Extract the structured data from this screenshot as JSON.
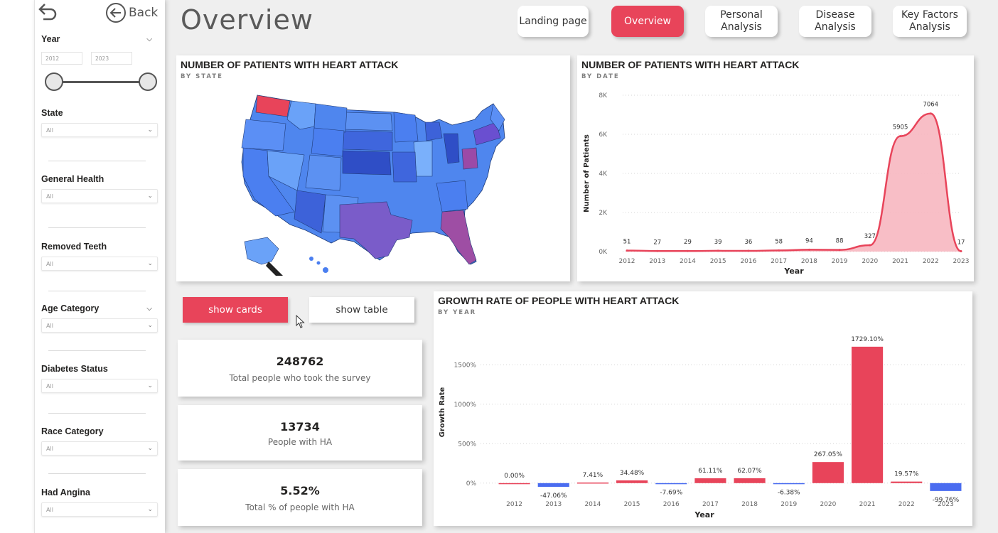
{
  "nav": {
    "back_label": "Back",
    "page_title": "Overview",
    "buttons": [
      "Landing page",
      "Overview",
      "Personal\nAnalysis",
      "Disease\nAnalysis",
      "Key Factors\nAnalysis"
    ]
  },
  "filters": {
    "year": {
      "title": "Year",
      "from": "2012",
      "to": "2023"
    },
    "state": {
      "title": "State",
      "value": "All"
    },
    "general_health": {
      "title": "General Health",
      "value": "All"
    },
    "removed_teeth": {
      "title": "Removed Teeth",
      "value": "All"
    },
    "age_category": {
      "title": "Age Category",
      "value": "All"
    },
    "diabetes_status": {
      "title": "Diabetes Status",
      "value": "All"
    },
    "race_category": {
      "title": "Race Category",
      "value": "All"
    },
    "had_angina": {
      "title": "Had Angina",
      "value": "All"
    }
  },
  "map_panel": {
    "title": "NUMBER OF PATIENTS WITH HEART ATTACK",
    "subtitle": "BY STATE"
  },
  "toggle": {
    "show_cards": "show cards",
    "show_table": "show table"
  },
  "cards": [
    {
      "value": "248762",
      "label": "Total people who took the survey"
    },
    {
      "value": "13734",
      "label": "People with HA"
    },
    {
      "value": "5.52%",
      "label": "Total % of people with HA"
    }
  ],
  "colors": {
    "accent": "#e8445a",
    "negative": "#4a6cf0",
    "area_fill": "#f7b7c0"
  },
  "chart_data": [
    {
      "type": "area",
      "title": "NUMBER OF PATIENTS WITH HEART ATTACK",
      "subtitle": "BY DATE",
      "xlabel": "Year",
      "ylabel": "Number of Patients",
      "categories": [
        "2012",
        "2013",
        "2014",
        "2015",
        "2016",
        "2017",
        "2018",
        "2019",
        "2020",
        "2021",
        "2022",
        "2023"
      ],
      "values": [
        51,
        27,
        29,
        39,
        36,
        58,
        94,
        88,
        327,
        5905,
        7064,
        17
      ],
      "data_labels": [
        "51",
        "27",
        "29",
        "39",
        "36",
        "58",
        "94",
        "88",
        "327",
        "5905",
        "7064",
        "17"
      ],
      "yticks": [
        "0K",
        "2K",
        "4K",
        "6K",
        "8K"
      ],
      "ylim": [
        0,
        8000
      ],
      "grid": true
    },
    {
      "type": "bar",
      "title": "GROWTH RATE OF PEOPLE WITH HEART ATTACK",
      "subtitle": "BY YEAR",
      "xlabel": "Year",
      "ylabel": "Growth Rate",
      "categories": [
        "2012",
        "2013",
        "2014",
        "2015",
        "2016",
        "2017",
        "2018",
        "2019",
        "2020",
        "2021",
        "2022",
        "2023"
      ],
      "values": [
        0.0,
        -47.06,
        7.41,
        34.48,
        -7.69,
        61.11,
        62.07,
        -6.38,
        267.05,
        1729.1,
        19.57,
        -99.76
      ],
      "data_labels": [
        "0.00%",
        "-47.06%",
        "7.41%",
        "34.48%",
        "-7.69%",
        "61.11%",
        "62.07%",
        "-6.38%",
        "267.05%",
        "1729.10%",
        "19.57%",
        "-99.76%"
      ],
      "yticks": [
        "0%",
        "500%",
        "1000%",
        "1500%"
      ],
      "ylim": [
        -200,
        1800
      ],
      "grid": true
    }
  ]
}
